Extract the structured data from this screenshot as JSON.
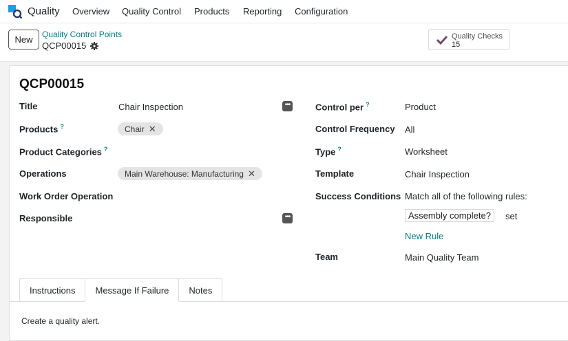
{
  "topnav": {
    "app_name": "Quality",
    "menu": [
      "Overview",
      "Quality Control",
      "Products",
      "Reporting",
      "Configuration"
    ]
  },
  "control_panel": {
    "new_label": "New",
    "breadcrumb_parent": "Quality Control Points",
    "breadcrumb_current": "QCP00015",
    "stat_button": {
      "label": "Quality Checks",
      "value": "15"
    }
  },
  "record": {
    "title": "QCP00015",
    "left": {
      "title_label": "Title",
      "title_value": "Chair Inspection",
      "products_label": "Products",
      "products_tag": "Chair",
      "product_categories_label": "Product Categories",
      "operations_label": "Operations",
      "operations_tag": "Main Warehouse: Manufacturing",
      "work_order_label": "Work Order Operation",
      "responsible_label": "Responsible"
    },
    "right": {
      "control_per_label": "Control per",
      "control_per_value": "Product",
      "control_frequency_label": "Control Frequency",
      "control_frequency_value": "All",
      "type_label": "Type",
      "type_value": "Worksheet",
      "template_label": "Template",
      "template_value": "Chair Inspection",
      "success_label": "Success Conditions",
      "success_value": "Match all of the following rules:",
      "rule_field": "Assembly complete?",
      "rule_operator": "set",
      "new_rule": "New Rule",
      "team_label": "Team",
      "team_value": "Main Quality Team"
    },
    "help_mark": "?"
  },
  "tabs": {
    "items": [
      "Instructions",
      "Message If Failure",
      "Notes"
    ],
    "active": "Message If Failure",
    "content": "Create a quality alert."
  },
  "colors": {
    "accent": "#017e84",
    "logo_blue": "#1ea0e0",
    "logo_dark": "#2a3b73",
    "check": "#714b67"
  }
}
